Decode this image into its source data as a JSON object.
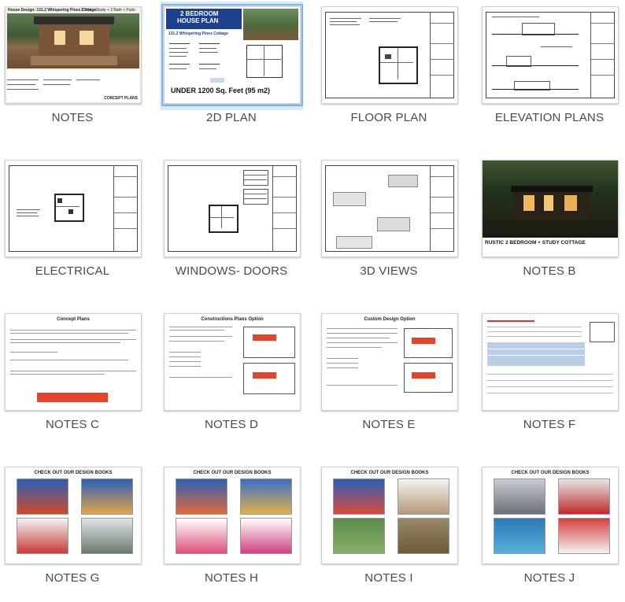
{
  "items": [
    {
      "label": "NOTES",
      "selected": false
    },
    {
      "label": "2D PLAN",
      "selected": true
    },
    {
      "label": "FLOOR PLAN",
      "selected": false
    },
    {
      "label": "ELEVATION PLANS",
      "selected": false
    },
    {
      "label": "ELECTRICAL",
      "selected": false
    },
    {
      "label": "WINDOWS- DOORS",
      "selected": false
    },
    {
      "label": "3D VIEWS",
      "selected": false
    },
    {
      "label": "NOTES  B",
      "selected": false
    },
    {
      "label": "NOTES  C",
      "selected": false
    },
    {
      "label": "NOTES  D",
      "selected": false
    },
    {
      "label": "NOTES  E",
      "selected": false
    },
    {
      "label": "NOTES  F",
      "selected": false
    },
    {
      "label": "NOTES  G",
      "selected": false
    },
    {
      "label": "NOTES  H",
      "selected": false
    },
    {
      "label": "NOTES  I",
      "selected": false
    },
    {
      "label": "NOTES  J",
      "selected": false
    }
  ],
  "thumbs": {
    "notes": {
      "top_caption": "House Design: 131.2 Whispering Pines Cottage",
      "sub_caption": "2 Bed + Study + 2 Bath + Patio",
      "corner": "CONCEPT PLANS"
    },
    "plan2d": {
      "title1": "2 BEDROOM",
      "title2": "HOUSE PLAN",
      "subtitle": "131.2 Whispering Pines Cottage",
      "footer": "UNDER 1200 Sq. Feet (95 m2)"
    },
    "notes_b": {
      "caption": "RUSTIC 2 BEDROOM + STUDY COTTAGE"
    },
    "notes_c": {
      "header": "Concept Plans"
    },
    "notes_d": {
      "header": "Constructions Plans Option"
    },
    "notes_e": {
      "header": "Custom Design Option"
    },
    "notes_g": {
      "header": "CHECK OUT OUR DESIGN BOOKS"
    },
    "notes_h": {
      "header": "CHECK OUT OUR DESIGN BOOKS"
    },
    "notes_i": {
      "header": "CHECK OUT OUR DESIGN BOOKS"
    },
    "notes_j": {
      "header": "CHECK OUT OUR DESIGN BOOKS"
    }
  },
  "colors": {
    "selection": "#d9e8fb",
    "accent_red": "#e4442a",
    "plan_blue": "#1d3f8f",
    "label": "#4a4a4a"
  }
}
